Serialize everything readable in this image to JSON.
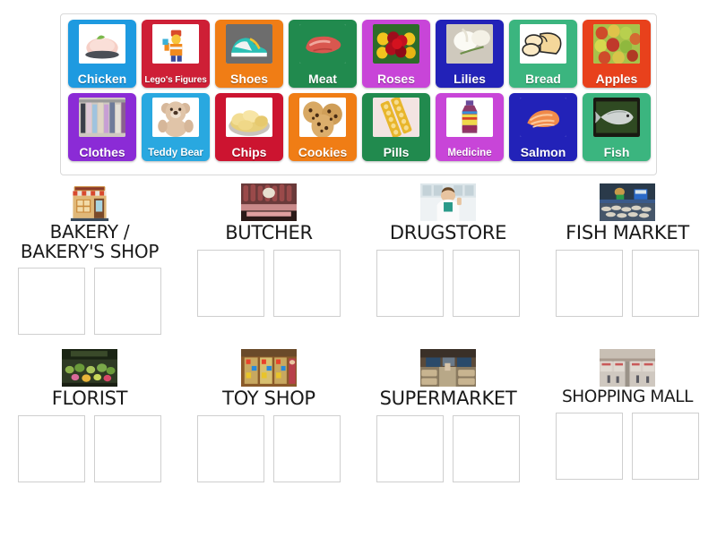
{
  "activity": {
    "type": "group-sort",
    "title": "Shops and Products Group Sort"
  },
  "tray": {
    "rows": [
      [
        {
          "label": "Chicken",
          "icon": "chicken-photo-icon",
          "bg": "#1e9ae0",
          "size": "lg"
        },
        {
          "label": "Lego's Figures",
          "icon": "lego-figure-photo-icon",
          "bg": "#ce1f36",
          "size": "sm"
        },
        {
          "label": "Shoes",
          "icon": "sneakers-photo-icon",
          "bg": "#f07d15",
          "size": "lg"
        },
        {
          "label": "Meat",
          "icon": "steak-photo-icon",
          "bg": "#218a4e",
          "size": "lg"
        },
        {
          "label": "Roses",
          "icon": "roses-photo-icon",
          "bg": "#c845d8",
          "size": "lg"
        },
        {
          "label": "Lilies",
          "icon": "lilies-photo-icon",
          "bg": "#2222b8",
          "size": "lg"
        },
        {
          "label": "Bread",
          "icon": "bread-loaf-photo-icon",
          "bg": "#3bb57f",
          "size": "lg"
        },
        {
          "label": "Apples",
          "icon": "apples-photo-icon",
          "bg": "#e8411c",
          "size": "lg"
        }
      ],
      [
        {
          "label": "Clothes",
          "icon": "clothes-rack-photo-icon",
          "bg": "#8b2bd6",
          "size": "lg"
        },
        {
          "label": "Teddy Bear",
          "icon": "teddy-bear-photo-icon",
          "bg": "#29a8e0",
          "size": "md"
        },
        {
          "label": "Chips",
          "icon": "potato-chips-photo-icon",
          "bg": "#cc1430",
          "size": "lg"
        },
        {
          "label": "Cookies",
          "icon": "cookies-photo-icon",
          "bg": "#f07d15",
          "size": "lg"
        },
        {
          "label": "Pills",
          "icon": "pill-blister-photo-icon",
          "bg": "#218a4e",
          "size": "lg"
        },
        {
          "label": "Medicine",
          "icon": "medicine-bottle-photo-icon",
          "bg": "#c845d8",
          "size": "md"
        },
        {
          "label": "Salmon",
          "icon": "salmon-fillet-photo-icon",
          "bg": "#2222b8",
          "size": "lg"
        },
        {
          "label": "Fish",
          "icon": "whole-fish-photo-icon",
          "bg": "#3bb57f",
          "size": "lg"
        }
      ]
    ]
  },
  "categories": {
    "rows": [
      [
        {
          "title": "BAKERY /\nBAKERY'S SHOP",
          "icon": "bakery-shop-photo-icon",
          "slots": 2,
          "style": "two-line"
        },
        {
          "title": "BUTCHER",
          "icon": "butcher-shop-photo-icon",
          "slots": 2,
          "style": ""
        },
        {
          "title": "DRUGSTORE",
          "icon": "pharmacist-photo-icon",
          "slots": 2,
          "style": ""
        },
        {
          "title": "FISH MARKET",
          "icon": "fish-market-photo-icon",
          "slots": 2,
          "style": ""
        }
      ],
      [
        {
          "title": "FLORIST",
          "icon": "florist-shop-photo-icon",
          "slots": 2,
          "style": ""
        },
        {
          "title": "TOY SHOP",
          "icon": "toy-shop-photo-icon",
          "slots": 2,
          "style": ""
        },
        {
          "title": "SUPERMARKET",
          "icon": "supermarket-photo-icon",
          "slots": 2,
          "style": ""
        },
        {
          "title": "SHOPPING MALL",
          "icon": "shopping-mall-photo-icon",
          "slots": 2,
          "style": "narrow"
        }
      ]
    ]
  },
  "colors": {
    "panel_border": "#d8d8d8",
    "dropzone_border": "#cfcfcf",
    "text": "#1a1a1a",
    "tile_text": "#ffffff",
    "page_background": "#ffffff"
  }
}
